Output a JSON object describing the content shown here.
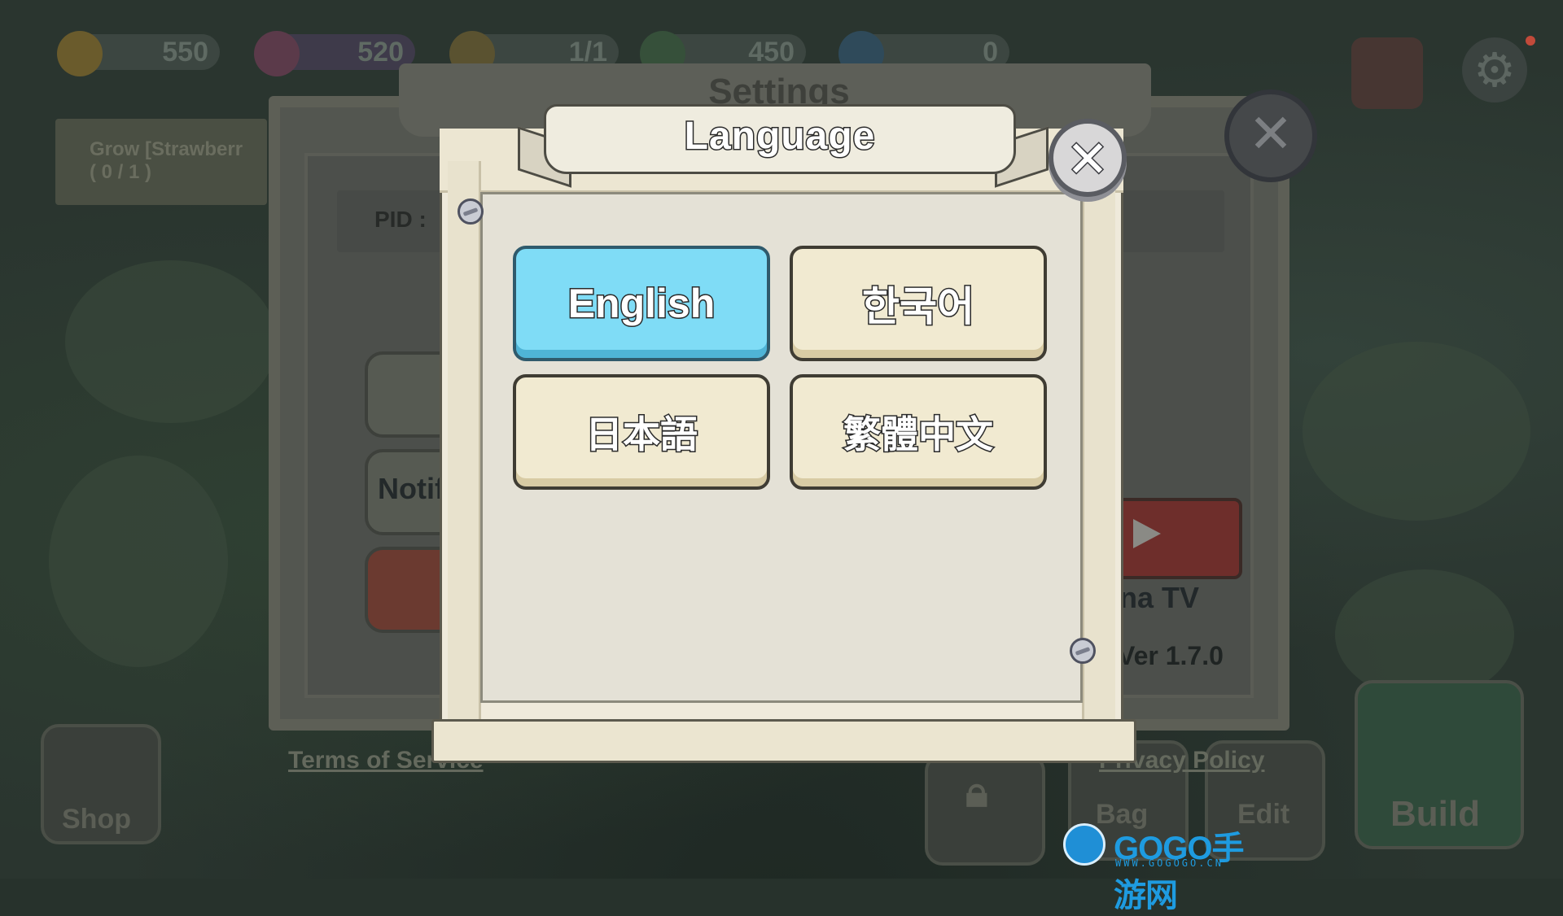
{
  "hud": {
    "coins": "550",
    "gems": "520",
    "workers": "1/1",
    "leaves": "450",
    "crystals": "0"
  },
  "quest": {
    "text": "Grow [Strawberr",
    "progress": "( 0 / 1 )"
  },
  "settings": {
    "title": "Settings",
    "pid_label": "PID :",
    "notifications_label": "Notif",
    "version": "Ver 1.7.0",
    "tv_label": "na TV",
    "terms": "Terms of Service",
    "privacy": "Privacy Policy",
    "close_icon": "close-icon"
  },
  "bottom_bar": {
    "shop": "Shop",
    "bag": "Bag",
    "edit": "Edit",
    "build": "Build"
  },
  "language_dialog": {
    "title": "Language",
    "close_icon": "close-icon",
    "options": [
      {
        "label": "English",
        "selected": true
      },
      {
        "label": "한국어",
        "selected": false
      },
      {
        "label": "日本語",
        "selected": false
      },
      {
        "label": "繁體中文",
        "selected": false
      }
    ],
    "selected_color": "#7fdcf6",
    "unselected_color": "#f1ead1"
  },
  "watermark": {
    "brand": "GOGO手游网",
    "url": "WWW.GOGOGO.CN"
  }
}
